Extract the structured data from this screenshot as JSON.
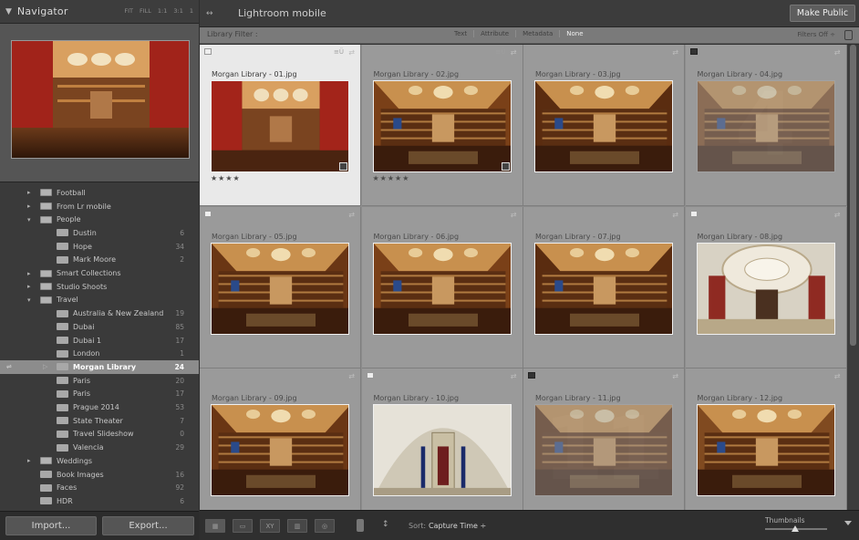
{
  "navigator": {
    "title": "Navigator",
    "zoom_options": [
      "FIT",
      "FILL",
      "1:1",
      "3:1",
      "1"
    ]
  },
  "folders": [
    {
      "label": "Football",
      "count": "",
      "level": 0,
      "arrow": "▸",
      "icon": "collection-set-icon"
    },
    {
      "label": "From Lr mobile",
      "count": "",
      "level": 0,
      "arrow": "▸",
      "icon": "collection-set-icon"
    },
    {
      "label": "People",
      "count": "",
      "level": 0,
      "arrow": "▾",
      "icon": "collection-set-icon"
    },
    {
      "label": "Dustin",
      "count": "6",
      "level": 1,
      "arrow": "",
      "icon": "collection-icon"
    },
    {
      "label": "Hope",
      "count": "34",
      "level": 1,
      "arrow": "",
      "icon": "collection-icon"
    },
    {
      "label": "Mark Moore",
      "count": "2",
      "level": 1,
      "arrow": "",
      "icon": "collection-icon"
    },
    {
      "label": "Smart Collections",
      "count": "",
      "level": 0,
      "arrow": "▸",
      "icon": "collection-set-icon"
    },
    {
      "label": "Studio Shoots",
      "count": "",
      "level": 0,
      "arrow": "▸",
      "icon": "collection-set-icon"
    },
    {
      "label": "Travel",
      "count": "",
      "level": 0,
      "arrow": "▾",
      "icon": "collection-set-icon"
    },
    {
      "label": "Australia & New Zealand",
      "count": "19",
      "level": 1,
      "arrow": "",
      "icon": "collection-icon"
    },
    {
      "label": "Dubai",
      "count": "85",
      "level": 1,
      "arrow": "",
      "icon": "collection-icon"
    },
    {
      "label": "Dubai 1",
      "count": "17",
      "level": 1,
      "arrow": "",
      "icon": "collection-icon"
    },
    {
      "label": "London",
      "count": "1",
      "level": 1,
      "arrow": "",
      "icon": "collection-icon"
    },
    {
      "label": "Morgan Library",
      "count": "24",
      "level": 1,
      "arrow": "▷",
      "icon": "collection-icon",
      "selected": true
    },
    {
      "label": "Paris",
      "count": "20",
      "level": 1,
      "arrow": "",
      "icon": "collection-icon"
    },
    {
      "label": "Paris",
      "count": "17",
      "level": 1,
      "arrow": "",
      "icon": "collection-icon"
    },
    {
      "label": "Prague 2014",
      "count": "53",
      "level": 1,
      "arrow": "",
      "icon": "collection-icon"
    },
    {
      "label": "State Theater",
      "count": "7",
      "level": 1,
      "arrow": "",
      "icon": "collection-icon"
    },
    {
      "label": "Travel Slideshow",
      "count": "0",
      "level": 1,
      "arrow": "",
      "icon": "collection-icon"
    },
    {
      "label": "Valencia",
      "count": "29",
      "level": 1,
      "arrow": "",
      "icon": "collection-icon"
    },
    {
      "label": "Weddings",
      "count": "",
      "level": 0,
      "arrow": "▸",
      "icon": "collection-set-icon"
    },
    {
      "label": "Book Images",
      "count": "16",
      "level": 0,
      "arrow": "",
      "icon": "collection-icon"
    },
    {
      "label": "Faces",
      "count": "92",
      "level": 0,
      "arrow": "",
      "icon": "collection-icon"
    },
    {
      "label": "HDR",
      "count": "6",
      "level": 0,
      "arrow": "",
      "icon": "collection-icon"
    }
  ],
  "buttons": {
    "import": "Import...",
    "export": "Export..."
  },
  "topbar": {
    "back_icon": "back-arrow-icon",
    "title": "Lightroom mobile",
    "make_public": "Make Public"
  },
  "filter": {
    "label": "Library Filter :",
    "options": [
      "Text",
      "Attribute",
      "Metadata",
      "None"
    ],
    "active": "None",
    "filters_off": "Filters Off ÷"
  },
  "grid": {
    "cells": [
      {
        "num": "1",
        "name": "Morgan Library - 01.jpg",
        "stars": "★★★★",
        "flag": "white",
        "selected": true,
        "dim": false,
        "badge": true,
        "meta": "≡Ü"
      },
      {
        "num": "2",
        "name": "Morgan Library - 02.jpg",
        "stars": "★★★★★",
        "flag": "",
        "selected": false,
        "dim": false,
        "badge": true,
        "meta": "≡Ü"
      },
      {
        "num": "3",
        "name": "Morgan Library - 03.jpg",
        "stars": "",
        "flag": "",
        "selected": false,
        "dim": false,
        "badge": false,
        "meta": ""
      },
      {
        "num": "4",
        "name": "Morgan Library - 04.jpg",
        "stars": "",
        "flag": "dark",
        "selected": false,
        "dim": true,
        "badge": false,
        "meta": ""
      },
      {
        "num": "5",
        "name": "Morgan Library - 05.jpg",
        "stars": "",
        "flag": "white",
        "selected": false,
        "dim": false,
        "badge": false,
        "meta": ""
      },
      {
        "num": "6",
        "name": "Morgan Library - 06.jpg",
        "stars": "",
        "flag": "",
        "selected": false,
        "dim": false,
        "badge": false,
        "meta": ""
      },
      {
        "num": "7",
        "name": "Morgan Library - 07.jpg",
        "stars": "",
        "flag": "",
        "selected": false,
        "dim": false,
        "badge": false,
        "meta": ""
      },
      {
        "num": "8",
        "name": "Morgan Library - 08.jpg",
        "stars": "",
        "flag": "white",
        "selected": false,
        "dim": false,
        "badge": false,
        "meta": ""
      },
      {
        "num": "9",
        "name": "Morgan Library - 09.jpg",
        "stars": "",
        "flag": "",
        "selected": false,
        "dim": false,
        "badge": false,
        "meta": ""
      },
      {
        "num": "10",
        "name": "Morgan Library - 10.jpg",
        "stars": "",
        "flag": "white",
        "selected": false,
        "dim": false,
        "badge": false,
        "meta": ""
      },
      {
        "num": "11",
        "name": "Morgan Library - 11.jpg",
        "stars": "",
        "flag": "dark",
        "selected": false,
        "dim": true,
        "badge": false,
        "meta": ""
      },
      {
        "num": "12",
        "name": "Morgan Library - 12.jpg",
        "stars": "",
        "flag": "",
        "selected": false,
        "dim": false,
        "badge": false,
        "meta": ""
      }
    ]
  },
  "toolbar": {
    "view_buttons": [
      "grid-view-icon",
      "loupe-view-icon",
      "XY",
      "survey-view-icon",
      "people-view-icon"
    ],
    "sort_label": "Sort:",
    "sort_value": "Capture Time ÷",
    "thumbnails_label": "Thumbnails",
    "thumbnail_size": 0.48
  },
  "colors": {
    "selected_cell": "#e9e9e9",
    "cell_bg": "#9a9a9a",
    "selected_folder": "#8c8c8c"
  }
}
